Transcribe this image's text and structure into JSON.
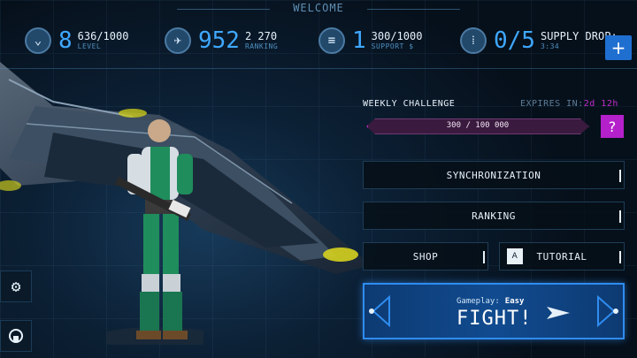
{
  "header": {
    "welcome": "WELCOME"
  },
  "stats": {
    "level": {
      "icon": "rank-chevron-icon",
      "big": "8",
      "value": "636/1000",
      "label": "LEVEL"
    },
    "ranking": {
      "icon": "wings-icon",
      "big": "952",
      "value": "2 270",
      "label": "RANKING"
    },
    "support": {
      "icon": "coins-icon",
      "big": "1",
      "value": "300/1000",
      "label": "SUPPORT $"
    },
    "supply": {
      "icon": "ammo-icon",
      "big": "0/5",
      "value": "SUPPLY DROP:",
      "label": "3:34"
    },
    "plus": "+"
  },
  "side": {
    "settings_icon": "gear-icon",
    "support_icon": "headset-icon"
  },
  "challenge": {
    "title": "WEEKLY CHALLENGE",
    "expires_label": "EXPIRES IN:",
    "expires_time": "2d 12h",
    "progress_text": "300 / 100 000",
    "progress_current": 300,
    "progress_total": 100000,
    "help": "?"
  },
  "menu": {
    "synchronization": "SYNCHRONIZATION",
    "ranking": "RANKING",
    "shop": "SHOP",
    "tutorial": "TUTORIAL",
    "tutorial_icon_text": "A"
  },
  "fight": {
    "gameplay_label": "Gameplay:",
    "difficulty": "Easy",
    "label": "FIGHT!"
  },
  "colors": {
    "accent_blue": "#3fa8ff",
    "challenge_purple": "#b12ac0",
    "fight_blue": "#114b8f"
  }
}
